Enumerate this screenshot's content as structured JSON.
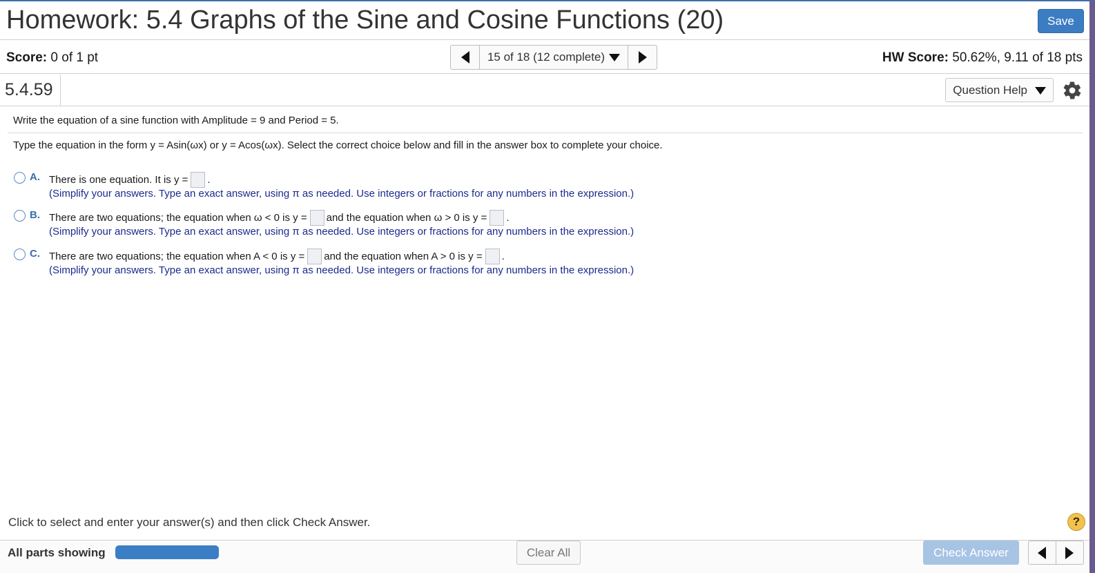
{
  "header": {
    "title": "Homework: 5.4 Graphs of the Sine and Cosine Functions (20)",
    "save_label": "Save"
  },
  "score_bar": {
    "score_label": "Score:",
    "score_value": " 0 of 1 pt",
    "nav_label": "15 of 18 (12 complete)",
    "hw_score_label": "HW Score:",
    "hw_score_value": " 50.62%, 9.11 of 18 pts"
  },
  "question_header": {
    "number": "5.4.59",
    "help_label": "Question Help"
  },
  "question": {
    "prompt": "Write the equation of a sine function with Amplitude = 9 and Period = 5.",
    "instructions": "Type the equation in the form y = Asin(ωx) or y = Acos(ωx). Select the correct choice below and fill in the answer box to complete your choice.",
    "choices": [
      {
        "letter": "A.",
        "text_a": "There is one equation. It is y =",
        "text_b": ".",
        "note": "(Simplify your answers. Type an exact answer, using π as needed. Use integers or fractions for any numbers in the expression.)"
      },
      {
        "letter": "B.",
        "text_a": "There are two equations; the equation when ω < 0 is y =",
        "text_b": "and the equation when ω > 0 is y =",
        "text_c": ".",
        "note": "(Simplify your answers. Type an exact answer, using π as needed. Use integers or fractions for any numbers in the expression.)"
      },
      {
        "letter": "C.",
        "text_a": "There are two equations; the equation when A < 0 is y =",
        "text_b": "and the equation when A > 0 is y =",
        "text_c": ".",
        "note": "(Simplify your answers. Type an exact answer, using π as needed. Use integers or fractions for any numbers in the expression.)"
      }
    ]
  },
  "footer": {
    "hint": "Click to select and enter your answer(s) and then click Check Answer.",
    "help_glyph": "?",
    "all_parts_label": "All parts showing",
    "progress_fraction": 1.0,
    "clear_all_label": "Clear All",
    "check_answer_label": "Check Answer"
  },
  "colors": {
    "accent": "#3b7cc2",
    "choice_letter": "#3b6cb0",
    "note_text": "#1a2a8c",
    "check_answer_disabled": "#a7c4e4"
  },
  "icons": [
    "chevron-left-icon",
    "chevron-right-icon",
    "caret-down-icon",
    "gear-icon",
    "help-icon"
  ]
}
